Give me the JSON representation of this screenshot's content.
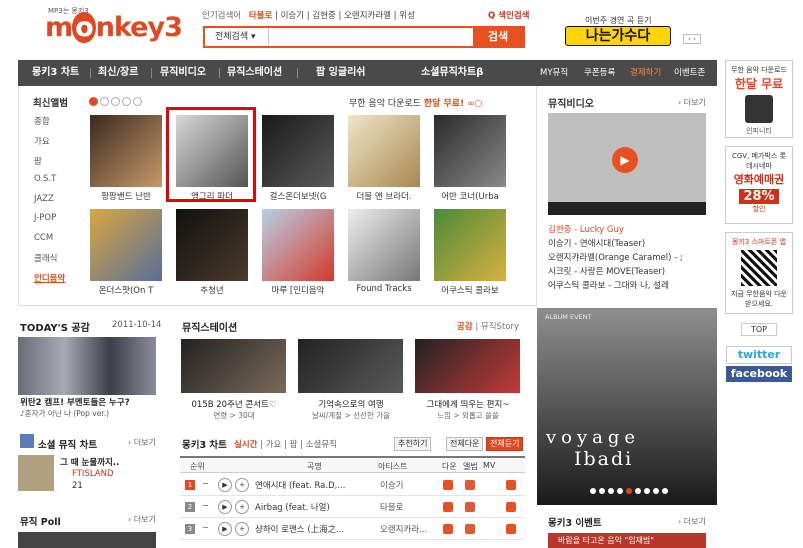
{
  "header": {
    "logo_tag": "MP3는 몽키3",
    "logo_main": "m",
    "logo_o": "o",
    "logo_rest": "nkey3",
    "popular_label": "인기검색어",
    "popular_terms": [
      "타블로",
      "이승기",
      "김현중",
      "오렌지카라멜",
      "위성"
    ],
    "quick_search": "Q 색인검색",
    "search": {
      "select_value": "전체검색 ▾",
      "placeholder": "",
      "button": "검색"
    },
    "promo_text": "이번주 경연 곡 듣기",
    "promo_banner": "나는가수다",
    "promo_arrows": "‹ ›"
  },
  "gnb": {
    "items": [
      "몽키3 차트",
      "최신/장르",
      "뮤직비디오",
      "뮤직스테이션",
      "팝 잉글리쉬",
      "소셜뮤직차트β"
    ],
    "sub_items": [
      "MY뮤직",
      "쿠폰등록",
      "결제하기",
      "이벤트존"
    ]
  },
  "new_albums": {
    "title": "최신앨범",
    "categories": [
      "종합",
      "가요",
      "팝",
      "O.S.T",
      "JAZZ",
      "J-POP",
      "CCM",
      "클래식",
      "인디음악"
    ],
    "selected_category": "인디음악",
    "free_msg": "무한 음악 다운로드 ",
    "free_hl": "한달 무료!",
    "albums": [
      {
        "title": "팡팡밴드 난반",
        "colors": [
          "#3a2a20",
          "#c79a6a"
        ]
      },
      {
        "title": "앵그리 파더",
        "colors": [
          "#d8d8d8",
          "#555"
        ]
      },
      {
        "title": "걸스온더보넷(G",
        "colors": [
          "#1a1a1a",
          "#5a5a5a"
        ]
      },
      {
        "title": "더블 앤 브라더.",
        "colors": [
          "#efe5c8",
          "#a88850"
        ]
      },
      {
        "title": "어반 코너(Urba",
        "colors": [
          "#2a2a2a",
          "#8a8a8a"
        ]
      },
      {
        "title": "온더스팟(On T",
        "colors": [
          "#d9a640",
          "#5a6e9a"
        ]
      },
      {
        "title": "추청년",
        "colors": [
          "#111",
          "#4a3a2a"
        ]
      },
      {
        "title": "마루 [인디음악",
        "colors": [
          "#b8d0e8",
          "#d23a2a"
        ]
      },
      {
        "title": "Found Tracks",
        "colors": [
          "#eee",
          "#777"
        ]
      },
      {
        "title": "어쿠스틱 콜라보",
        "colors": [
          "#4a8a3a",
          "#d9b040"
        ]
      }
    ]
  },
  "music_video": {
    "title": "뮤직비디오",
    "more": "› 더보기",
    "items": [
      "김현중 - Lucky Guy",
      "이승기 - 연애시대(Teaser)",
      "오렌지캬라멜(Orange Caramel) - ;",
      "시크릿 - 사랑은 MOVE(Teaser)",
      "어쿠스틱 콜라보 - 그대와 나, 설레"
    ],
    "highlight_index": 0
  },
  "today": {
    "title": "TODAY'S 공감",
    "date": "2011-10-14",
    "caption": "위탄2 캠프! 부멘토들은 누구?",
    "sub": "♪혼자가 아닌 나 (Pop ver.)"
  },
  "social_chart": {
    "title": "소셜 뮤직 차트",
    "more": "› 더보기",
    "song": "그 때 눈물까지..",
    "artist": "FTISLAND",
    "count": "21"
  },
  "poll": {
    "title": "뮤직 Poll",
    "more": "› 더보기"
  },
  "music_station": {
    "title": "뮤직스테이션",
    "tab_on": "공감",
    "tab_off": " | 뮤직Story",
    "items": [
      {
        "caption": "015B 20주년 콘서트♡",
        "sub": "연령 > 30대",
        "color": "#7a6a5a"
      },
      {
        "caption": "기억속으로의 여행",
        "sub": "날씨/계절 > 선선한 가을",
        "color": "#5a5a5a"
      },
      {
        "caption": "그대에게 띄우는 편지~",
        "sub": "느낌 > 외롭고 쓸쓸",
        "color": "#c43a3a"
      }
    ]
  },
  "chart": {
    "title": "몽키3 차트",
    "tab_on": "실시간",
    "tabs_off": " | 가요 | 팝 | 소셜뮤직",
    "btn_recommend": "추천하기",
    "btn_all_down": "전체다운",
    "btn_all_listen": "전체듣기",
    "head": [
      "순위",
      "곡명",
      "아티스트",
      "다운",
      "앨범",
      "MV"
    ],
    "rows": [
      {
        "rank": "1",
        "song": "연애시대 (feat. Ra.D,...",
        "artist": "이승기"
      },
      {
        "rank": "2",
        "song": "Airbag (feat. 나얼)",
        "artist": "타블로"
      },
      {
        "rank": "3",
        "song": "샹하이 로맨스 (上海之...",
        "artist": "오렌지카라..."
      }
    ]
  },
  "album_event": {
    "label": "ALBUM EVENT",
    "line1": "voyage",
    "line2": "Ibadi"
  },
  "event": {
    "title": "몽키3 이벤트",
    "more": "› 더보기",
    "banner": "바람을 타고온 음악 \"임재범\""
  },
  "sidebar": {
    "box1_a": "무한 음악 다운로드",
    "box1_b": "한달 무료",
    "box1_c": "인피니티",
    "box2_a": "CGV, 메가박스 롯데시네마",
    "box2_b": "영화예매권",
    "box2_c": "28%",
    "box2_d": "할인",
    "box3_a": "몽키3 스마트폰 앱",
    "box3_b": "지금 무한음악 다운 받으세요.",
    "top": "TOP",
    "twitter": "twitter",
    "facebook": "facebook"
  }
}
